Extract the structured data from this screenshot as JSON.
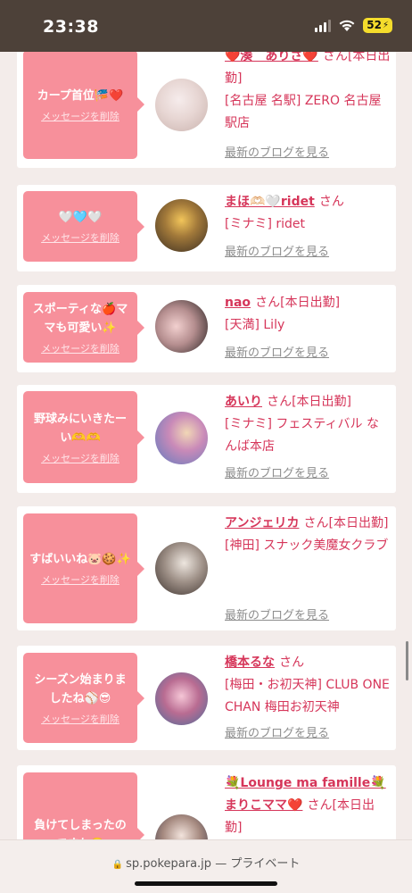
{
  "status_bar": {
    "time": "23:38",
    "battery": "52"
  },
  "cards": [
    {
      "message": "カープ首位🎏❤️",
      "delete": "メッセージを削除",
      "name": "❤️湊　ありさ❤️",
      "suffix": "さん[本日出勤]",
      "shop": "[名古屋 名駅] ZERO 名古屋駅店",
      "blog": "最新のブログを見る"
    },
    {
      "message": "🤍🩵🤍",
      "delete": "メッセージを削除",
      "name": "まほ🫶🏻🤍ridet",
      "suffix": "さん",
      "shop": "[ミナミ] ridet",
      "blog": "最新のブログを見る"
    },
    {
      "message": "スポーティな🍎ママも可愛い✨",
      "delete": "メッセージを削除",
      "name": "nao",
      "suffix": "さん[本日出勤]",
      "shop": "[天満] Lily",
      "blog": "最新のブログを見る"
    },
    {
      "message": "野球みにいきたーい🫶🫶",
      "delete": "メッセージを削除",
      "name": "あいり",
      "suffix": "さん[本日出勤]",
      "shop": "[ミナミ] フェスティバル なんば本店",
      "blog": "最新のブログを見る"
    },
    {
      "message": "すばいいね🐷🍪✨",
      "delete": "メッセージを削除",
      "name": "アンジェリカ",
      "suffix": "さん[本日出勤]",
      "shop": "[神田] スナック美魔女クラブ",
      "blog": "最新のブログを見る"
    },
    {
      "message": "シーズン始まりましたね⚾😎",
      "delete": "メッセージを削除",
      "name": "橋本るな",
      "suffix": "さん",
      "shop": "[梅田・お初天神] CLUB ONE CHAN 梅田お初天神",
      "blog": "最新のブログを見る"
    },
    {
      "message": "負けてしまったのですね🥺",
      "delete": "",
      "name": "💐Lounge ma famille💐まりこママ❤️",
      "suffix": "さん[本日出勤]",
      "shop": "",
      "blog": ""
    }
  ],
  "url_bar": {
    "domain": "sp.pokepara.jp",
    "separator": "—",
    "mode": "プライベート"
  }
}
